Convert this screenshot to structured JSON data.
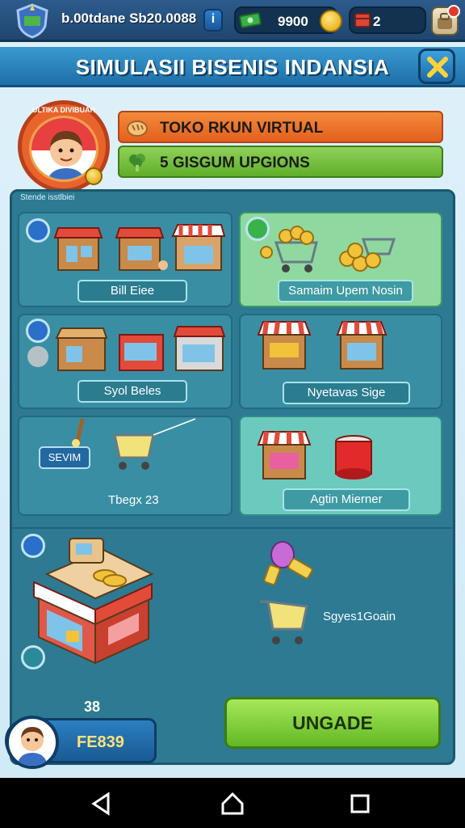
{
  "topbar": {
    "title": "b.00tdane Sb20.0088",
    "info_label": "i",
    "money": "9900",
    "gems": "2"
  },
  "header": {
    "title": "SIMULASII BISENIS INDANSIA"
  },
  "profile": {
    "avatar_ribbon": "ULTIKA DIVIBUAH",
    "shop_name": "TOKO RKUN VIRTUAL",
    "upgrades": "5 GISGUM UPGIONS"
  },
  "panel": {
    "label": "Stende isstlbiei",
    "tiles": [
      {
        "label": "Bill Eiee"
      },
      {
        "label": "Samaim Upem Nosin"
      },
      {
        "label": "Syol Beles"
      },
      {
        "label": "Nyetavas Sige"
      },
      {
        "tag": "SEVIM",
        "label": "Tbegx 23"
      },
      {
        "label": "Agtin Mierner"
      }
    ],
    "bottom_label": "Sgyes1Goain"
  },
  "footer": {
    "score": "38",
    "player_value": "FE839",
    "upgrade_button": "UNGADE"
  },
  "colors": {
    "accent_green": "#63b824",
    "accent_orange": "#e3601e",
    "panel_teal": "#2d7a92"
  }
}
